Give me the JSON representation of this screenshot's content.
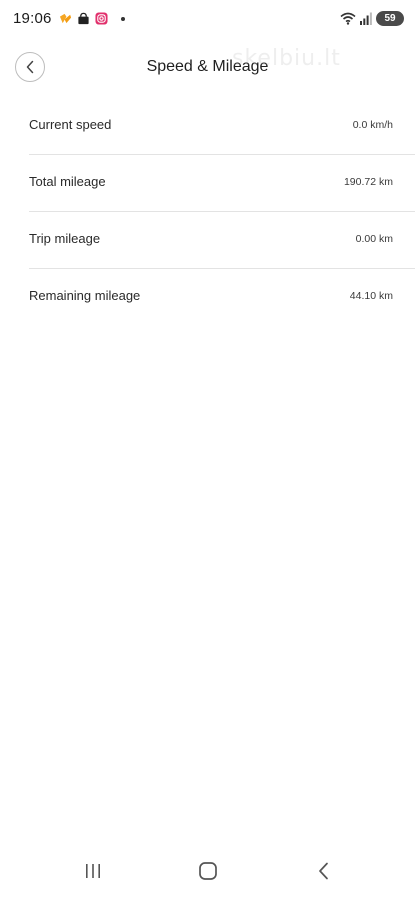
{
  "status_bar": {
    "time": "19:06",
    "battery": "59",
    "icons": [
      "delivery-app-icon",
      "shopping-bag-icon",
      "instagram-icon",
      "notification-dot-icon",
      "wifi-icon",
      "signal-icon",
      "battery-icon"
    ]
  },
  "header": {
    "title": "Speed & Mileage",
    "watermark": "skelbiu.lt"
  },
  "rows": [
    {
      "label": "Current speed",
      "value": "0.0 km/h"
    },
    {
      "label": "Total mileage",
      "value": "190.72 km"
    },
    {
      "label": "Trip mileage",
      "value": "0.00 km"
    },
    {
      "label": "Remaining mileage",
      "value": "44.10 km"
    }
  ],
  "colors": {
    "background": "#ffffff",
    "divider": "#e3e3e3",
    "text": "#2a2a2a",
    "delivery_icon": "#f5a623",
    "instagram_icon": "#e1306c"
  }
}
